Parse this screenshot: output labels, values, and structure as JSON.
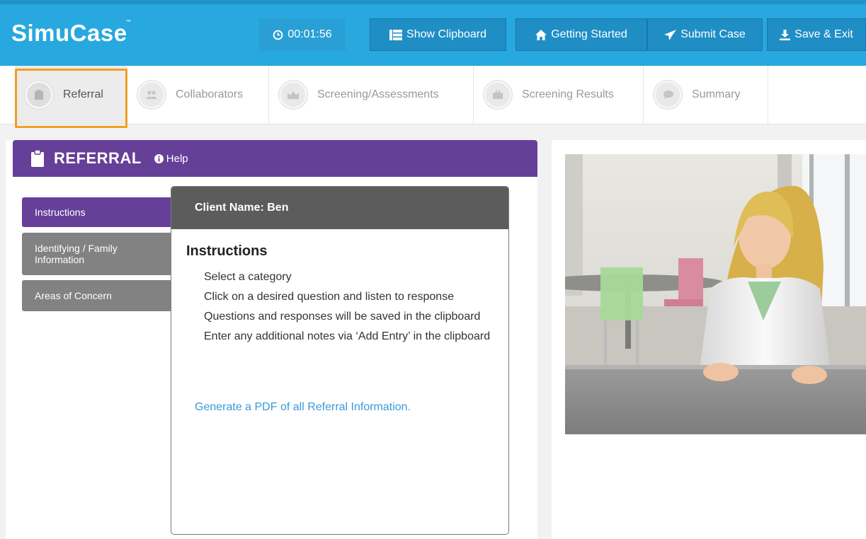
{
  "app": {
    "logo": "SimuCase",
    "logo_mark": "™"
  },
  "toolbar": {
    "timer": "00:01:56",
    "show_clipboard": "Show Clipboard",
    "getting_started": "Getting Started",
    "submit_case": "Submit Case",
    "save_exit": "Save & Exit"
  },
  "steps": [
    {
      "label": "Referral",
      "icon": "clipboard-icon",
      "active": true
    },
    {
      "label": "Collaborators",
      "icon": "people-icon",
      "active": false
    },
    {
      "label": "Screening/Assessments",
      "icon": "chart-icon",
      "active": false
    },
    {
      "label": "Screening Results",
      "icon": "briefcase-icon",
      "active": false
    },
    {
      "label": "Summary",
      "icon": "chat-icon",
      "active": false
    }
  ],
  "panel": {
    "title": "REFERRAL",
    "help": "Help"
  },
  "tabs": [
    {
      "label": "Instructions",
      "active": true
    },
    {
      "label": "Identifying / Family Information",
      "active": false
    },
    {
      "label": "Areas of Concern",
      "active": false
    }
  ],
  "instructions": {
    "client_name": "Client Name: Ben",
    "title": "Instructions",
    "items": [
      "Select a category",
      "Click on a desired question and listen to response",
      "Questions and responses will be saved in the clipboard",
      "Enter any additional notes via ‘Add Entry’ in the clipboard"
    ],
    "pdf_link": "Generate a PDF of all Referral Information."
  },
  "colors": {
    "header_blue": "#27a8de",
    "purple": "#663f99",
    "highlight_orange": "#f0a020",
    "link_blue": "#3a9ad9"
  }
}
